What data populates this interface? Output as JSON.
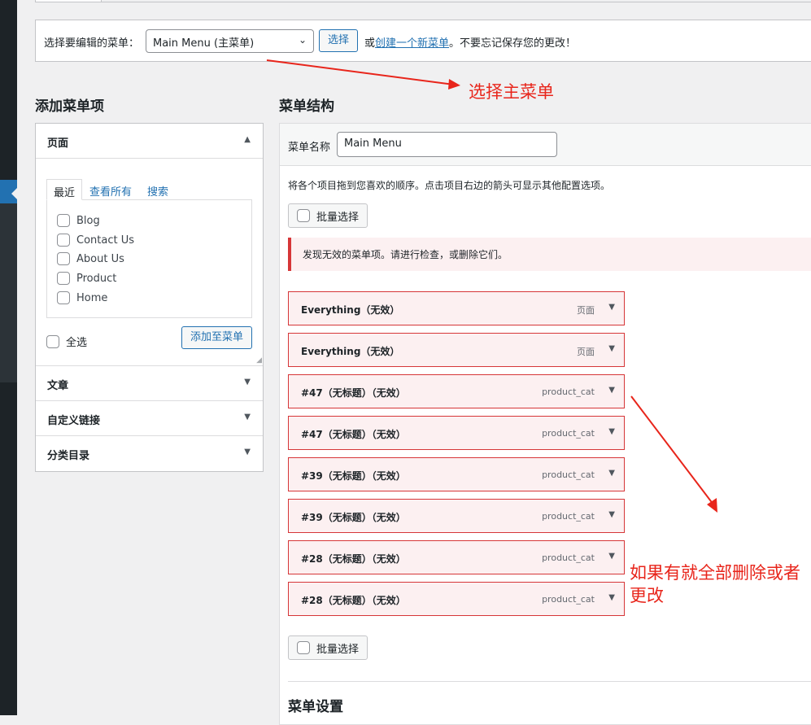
{
  "manage": {
    "label": "选择要编辑的菜单：",
    "selected": "Main Menu (主菜单)",
    "select_button": "选择",
    "or_text": "或",
    "create_link": "创建一个新菜单",
    "reminder": "。不要忘记保存您的更改！"
  },
  "left": {
    "heading": "添加菜单项",
    "pages_section": "页面",
    "tabs": [
      "最近",
      "查看所有",
      "搜索"
    ],
    "pages": [
      "Blog",
      "Contact Us",
      "About Us",
      "Product",
      "Home"
    ],
    "select_all": "全选",
    "add_button": "添加至菜单",
    "sections": [
      "文章",
      "自定义链接",
      "分类目录"
    ]
  },
  "right": {
    "heading": "菜单结构",
    "name_label": "菜单名称",
    "name_value": "Main Menu",
    "instructions": "将各个项目拖到您喜欢的顺序。点击项目右边的箭头可显示其他配置选项。",
    "bulk_select": "批量选择",
    "notice": "发现无效的菜单项。请进行检查，或删除它们。",
    "items": [
      {
        "title": "Everything（无效）",
        "type": "页面"
      },
      {
        "title": "Everything（无效）",
        "type": "页面"
      },
      {
        "title": "#47（无标题）（无效）",
        "type": "product_cat"
      },
      {
        "title": "#47（无标题）（无效）",
        "type": "product_cat"
      },
      {
        "title": "#39（无标题）（无效）",
        "type": "product_cat"
      },
      {
        "title": "#39（无标题）（无效）",
        "type": "product_cat"
      },
      {
        "title": "#28（无标题）（无效）",
        "type": "product_cat"
      },
      {
        "title": "#28（无标题）（无效）",
        "type": "product_cat"
      }
    ],
    "settings_heading": "菜单设置"
  },
  "annotations": {
    "select_main": "选择主菜单",
    "delete_note_line1": "如果有就全部删除或者",
    "delete_note_line2": "更改",
    "color": "#e8251b"
  },
  "icons": {
    "dropdown": "chevron-down-icon",
    "collapse": "triangle-up-icon",
    "expand": "triangle-down-icon"
  }
}
